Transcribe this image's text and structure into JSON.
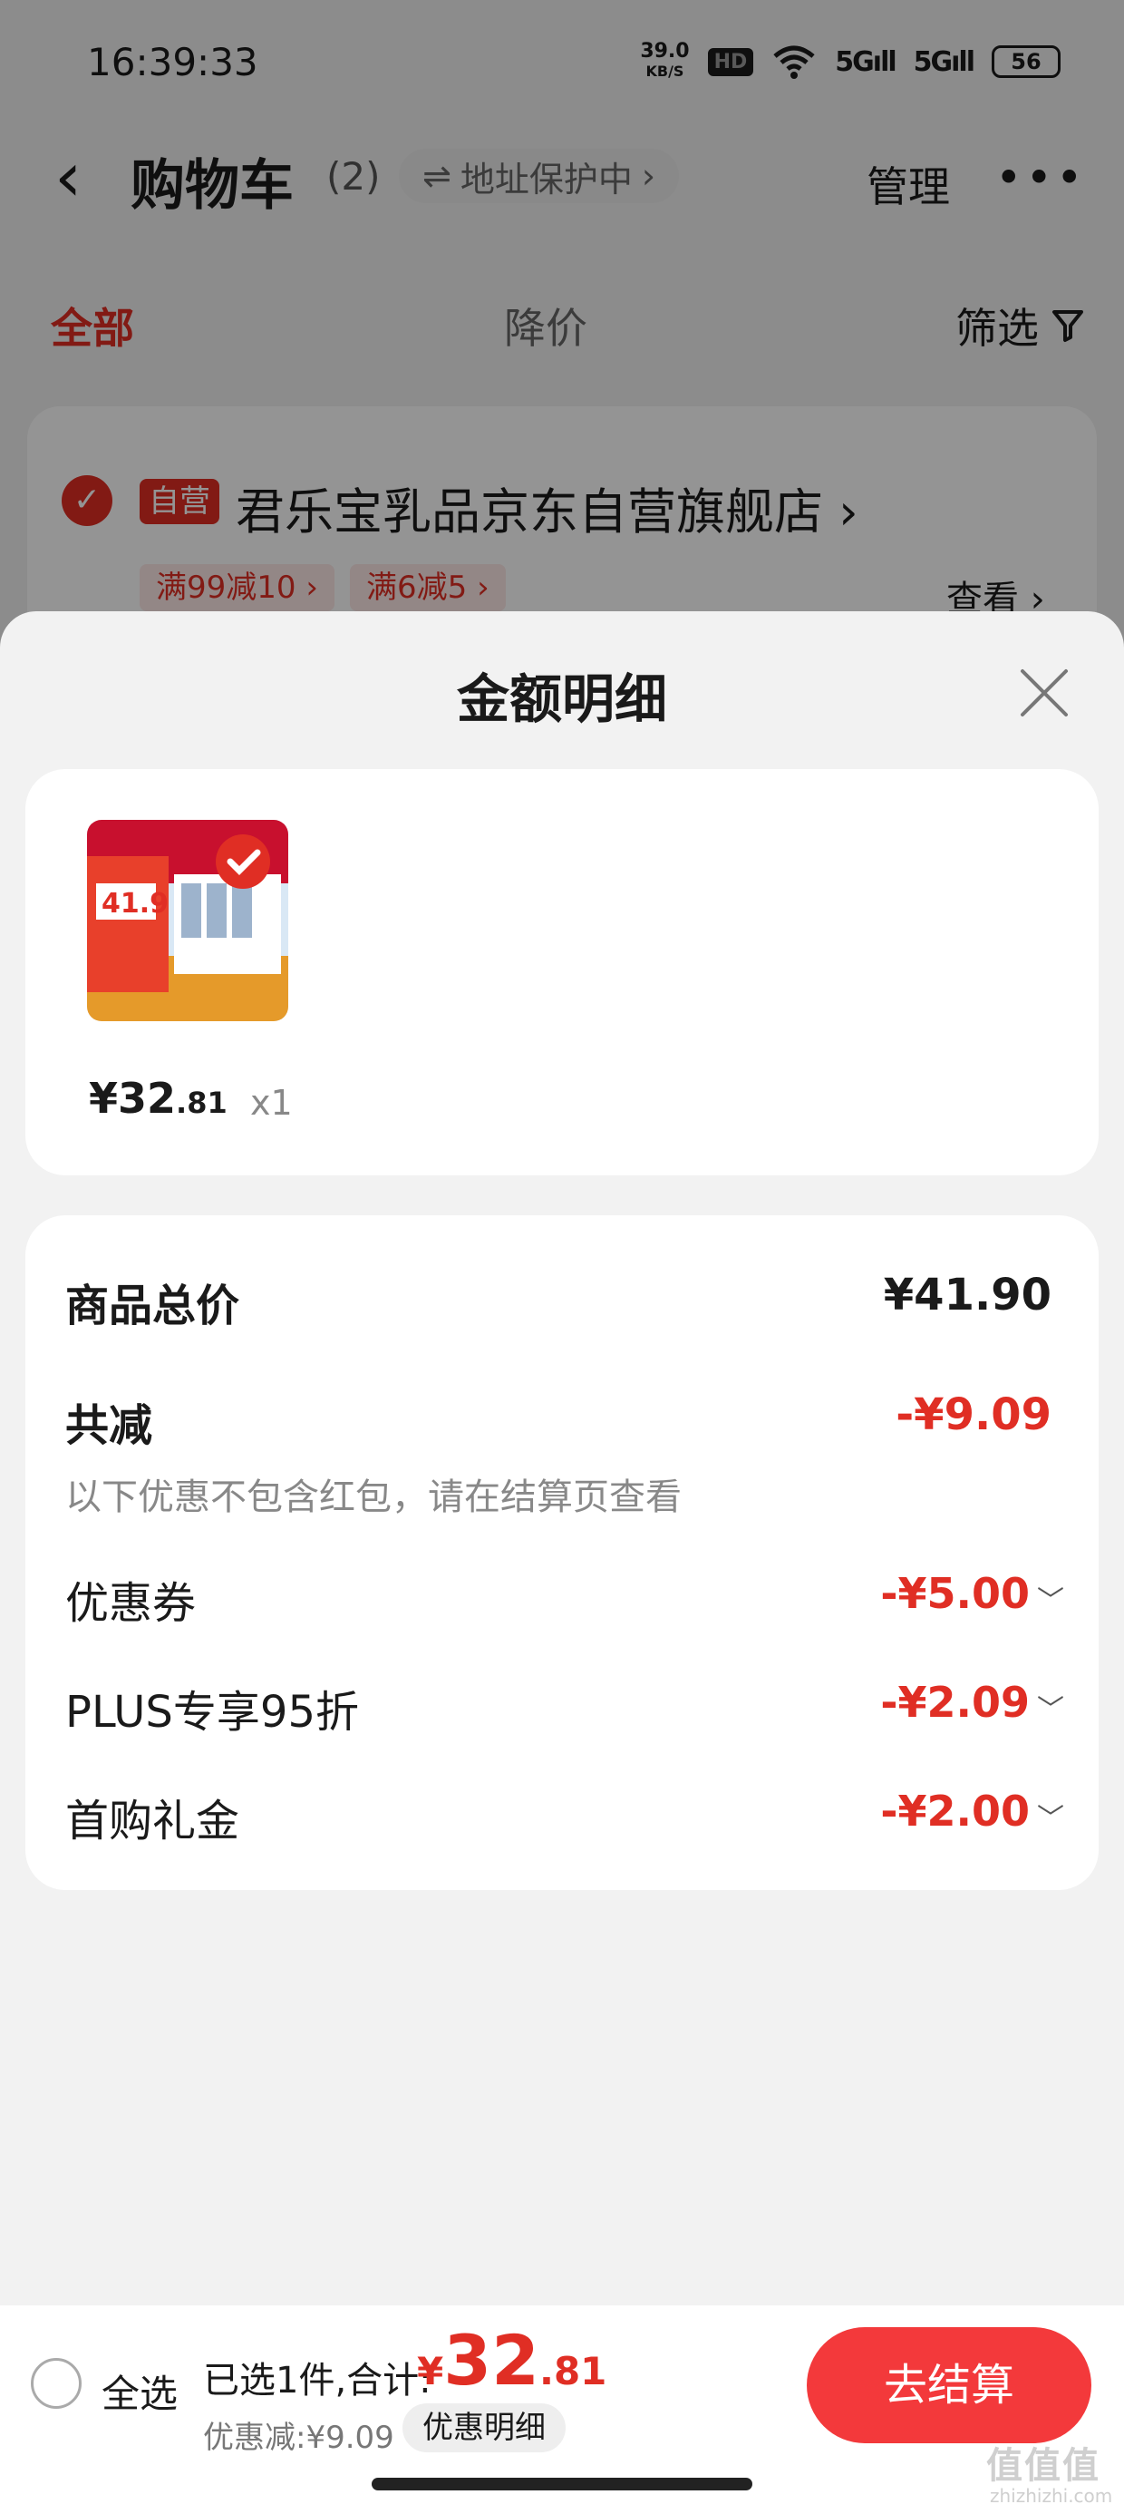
{
  "status_bar": {
    "time": "16:39:33",
    "net_speed_value": "39.0",
    "net_speed_unit": "KB/S",
    "hd": "HD",
    "sig1": "5G",
    "sig2": "5G",
    "battery": "56"
  },
  "header": {
    "title": "购物车",
    "count": "(2)",
    "address_protect": "地址保护中",
    "manage": "管理"
  },
  "tabs": {
    "all": "全部",
    "price_drop": "降价",
    "filter": "筛选"
  },
  "store": {
    "tag": "自营",
    "name": "君乐宝乳品京东自营旗舰店",
    "promos": [
      "满99减10",
      "满6减5"
    ],
    "view": "查看"
  },
  "sheet": {
    "title": "金额明细",
    "item": {
      "image_price_text": "41.9",
      "price_int": "¥32",
      "price_dec": ".81",
      "qty": "x1"
    },
    "total_label": "商品总价",
    "total_value": "¥41.90",
    "reduce_label": "共减",
    "reduce_value": "-¥9.09",
    "note": "以下优惠不包含红包，请在结算页查看",
    "discounts": [
      {
        "label": "优惠券",
        "value": "-¥5.00"
      },
      {
        "label": "PLUS专享95折",
        "value": "-¥2.09"
      },
      {
        "label": "首购礼金",
        "value": "-¥2.00"
      }
    ]
  },
  "bottom": {
    "select_all": "全选",
    "selected_summary": "已选1件,合计:",
    "total_yen": "¥",
    "total_int": "32",
    "total_dec": ".81",
    "saved": "优惠减:¥9.09",
    "discount_detail": "优惠明细",
    "checkout": "去结算"
  },
  "watermark": {
    "logo": "值值值",
    "site": "zhizhizhi.com"
  },
  "colors": {
    "accent": "#e02e24",
    "checkout": "#f3393b"
  }
}
